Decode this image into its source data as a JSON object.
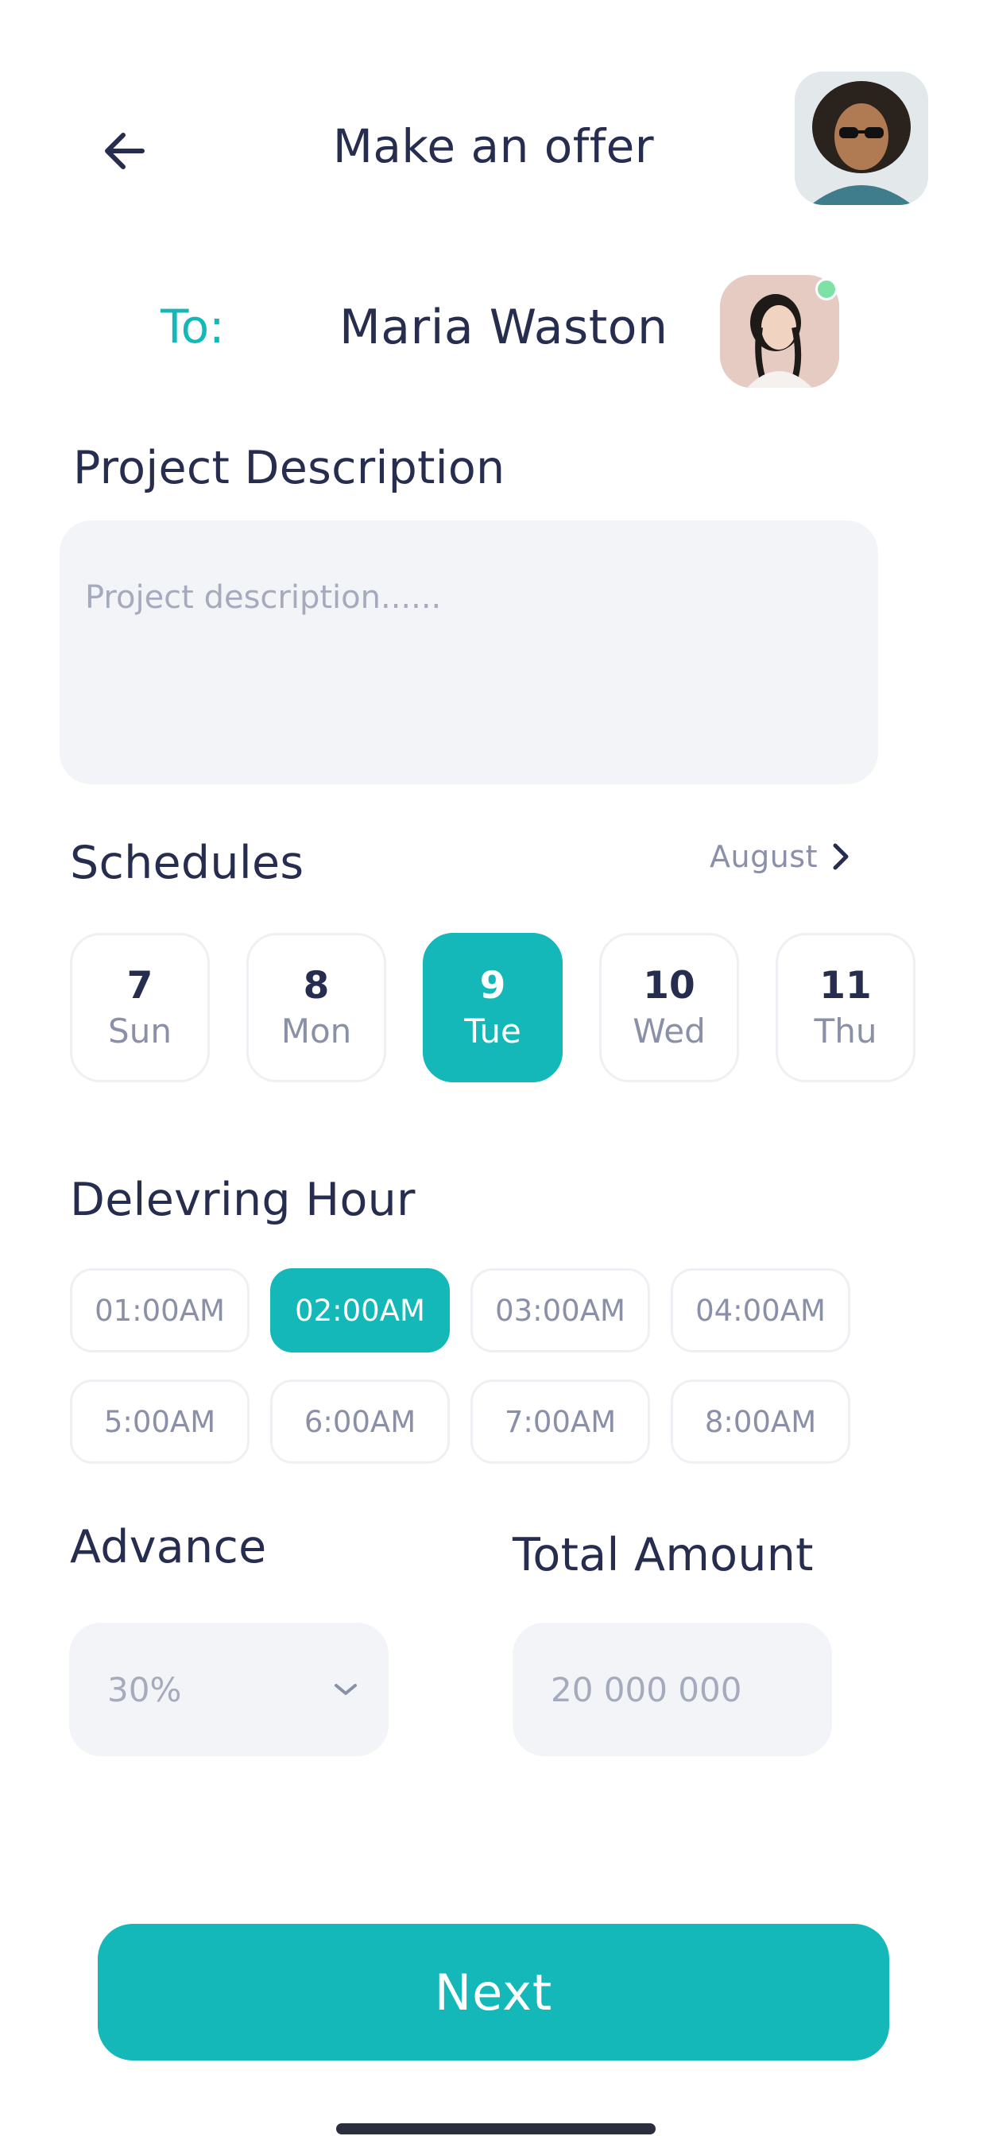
{
  "header": {
    "title": "Make an offer",
    "back_icon": "arrow-left-icon",
    "user_avatar": "user-avatar"
  },
  "recipient": {
    "label": "To:",
    "name": "Maria Waston",
    "online": true,
    "online_color": "#7ee2a8"
  },
  "description": {
    "heading": "Project Description",
    "placeholder": "Project description......",
    "value": ""
  },
  "schedules": {
    "heading": "Schedules",
    "month": "August",
    "month_icon": "chevron-right-icon",
    "days": [
      {
        "num": "7",
        "name": "Sun",
        "selected": false
      },
      {
        "num": "8",
        "name": "Mon",
        "selected": false
      },
      {
        "num": "9",
        "name": "Tue",
        "selected": true
      },
      {
        "num": "10",
        "name": "Wed",
        "selected": false
      },
      {
        "num": "11",
        "name": "Thu",
        "selected": false
      }
    ]
  },
  "hours": {
    "heading": "Delevring Hour",
    "options": [
      {
        "label": "01:00AM",
        "selected": false
      },
      {
        "label": "02:00AM",
        "selected": true
      },
      {
        "label": "03:00AM",
        "selected": false
      },
      {
        "label": "04:00AM",
        "selected": false
      },
      {
        "label": "5:00AM",
        "selected": false
      },
      {
        "label": "6:00AM",
        "selected": false
      },
      {
        "label": "7:00AM",
        "selected": false
      },
      {
        "label": "8:00AM",
        "selected": false
      }
    ]
  },
  "advance": {
    "heading": "Advance",
    "value": "30%",
    "icon": "chevron-down-icon"
  },
  "total": {
    "heading": "Total Amount",
    "placeholder": "20 000 000"
  },
  "next_label": "Next",
  "colors": {
    "accent": "#14b8b8",
    "text": "#262d4f",
    "muted": "#8a90a8",
    "field_bg": "#f3f4f7"
  }
}
